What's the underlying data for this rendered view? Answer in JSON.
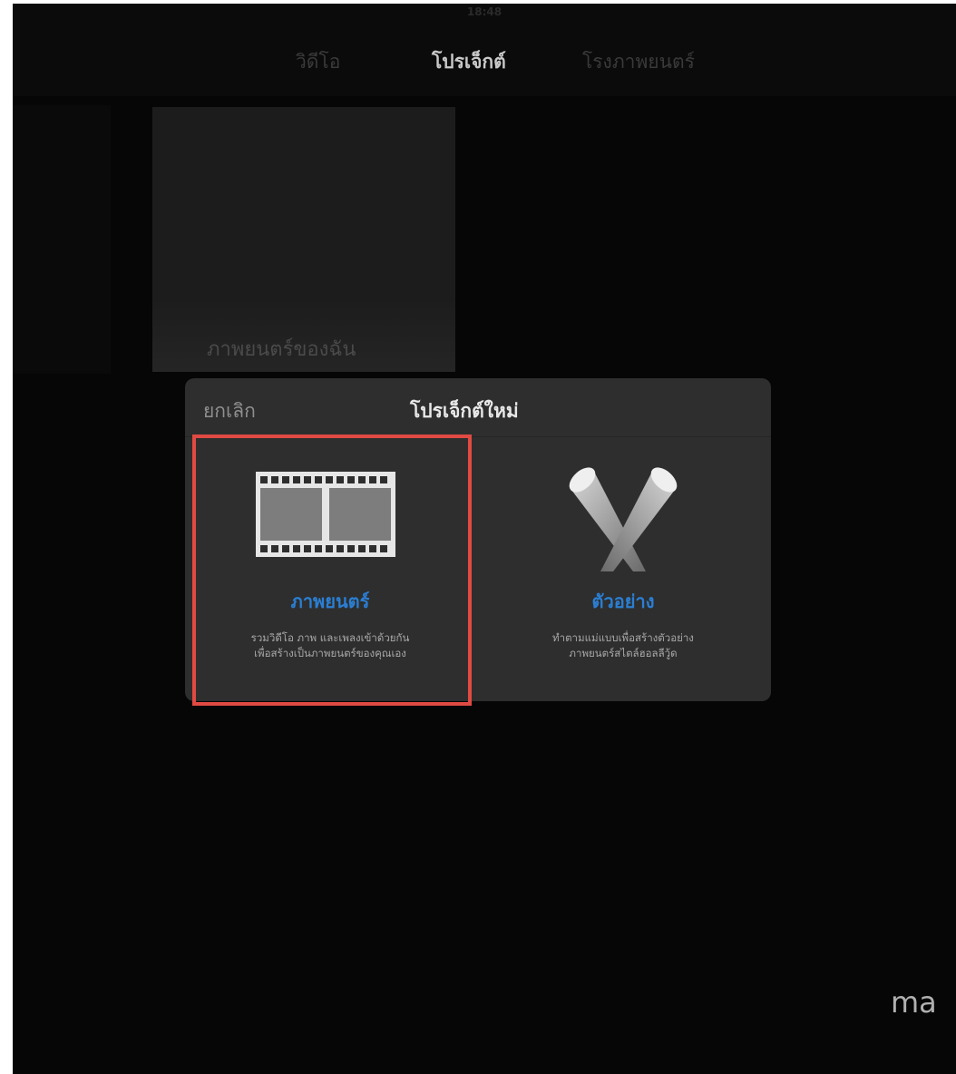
{
  "status": {
    "time": "18:48"
  },
  "tabs": [
    {
      "label": "วิดีโอ",
      "active": false
    },
    {
      "label": "โปรเจ็กต์",
      "active": true
    },
    {
      "label": "โรงภาพยนตร์",
      "active": false
    }
  ],
  "project": {
    "title": "ภาพยนตร์ของฉัน"
  },
  "sheet": {
    "cancel_label": "ยกเลิก",
    "title": "โปรเจ็กต์ใหม่",
    "options": [
      {
        "label": "ภาพยนตร์",
        "icon": "film-strip-icon",
        "desc_line1": "รวมวิดีโอ ภาพ และเพลงเข้าด้วยกัน",
        "desc_line2": "เพื่อสร้างเป็นภาพยนตร์ของคุณเอง",
        "highlighted": true
      },
      {
        "label": "ตัวอย่าง",
        "icon": "spotlight-icon",
        "desc_line1": "ทำตามแม่แบบเพื่อสร้างตัวอย่าง",
        "desc_line2": "ภาพยนตร์สไตล์ฮอลลีวู้ด",
        "highlighted": false
      }
    ]
  },
  "colors": {
    "accent": "#2a7fd4",
    "highlight_border": "#e04a42",
    "sheet_bg": "#2e2e2e",
    "screen_bg": "#060606"
  },
  "watermark": "ma"
}
